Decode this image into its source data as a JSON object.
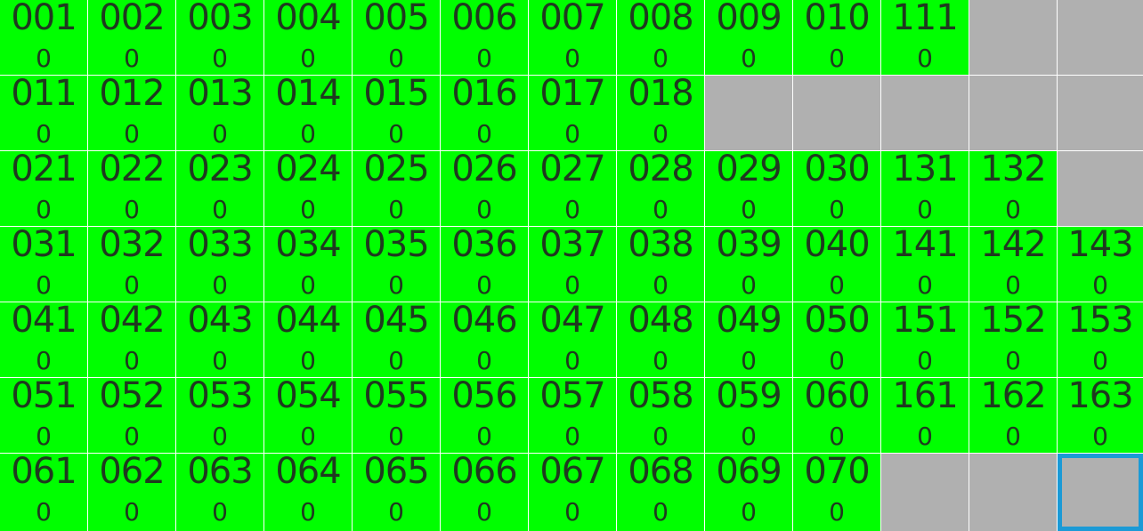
{
  "colors": {
    "active_tile": "#00ff00",
    "empty_tile": "#b0b0b0",
    "selection_border": "#1b9ad6",
    "text": "#1f3a1f",
    "gridline": "#ffffff"
  },
  "grid": {
    "rows": [
      [
        {
          "label": "001",
          "count": "0"
        },
        {
          "label": "002",
          "count": "0"
        },
        {
          "label": "003",
          "count": "0"
        },
        {
          "label": "004",
          "count": "0"
        },
        {
          "label": "005",
          "count": "0"
        },
        {
          "label": "006",
          "count": "0"
        },
        {
          "label": "007",
          "count": "0"
        },
        {
          "label": "008",
          "count": "0"
        },
        {
          "label": "009",
          "count": "0"
        },
        {
          "label": "010",
          "count": "0"
        },
        {
          "label": "111",
          "count": "0"
        },
        {
          "empty": true
        },
        {
          "empty": true
        }
      ],
      [
        {
          "label": "011",
          "count": "0"
        },
        {
          "label": "012",
          "count": "0"
        },
        {
          "label": "013",
          "count": "0"
        },
        {
          "label": "014",
          "count": "0"
        },
        {
          "label": "015",
          "count": "0"
        },
        {
          "label": "016",
          "count": "0"
        },
        {
          "label": "017",
          "count": "0"
        },
        {
          "label": "018",
          "count": "0"
        },
        {
          "empty": true
        },
        {
          "empty": true
        },
        {
          "empty": true
        },
        {
          "empty": true
        },
        {
          "empty": true
        }
      ],
      [
        {
          "label": "021",
          "count": "0"
        },
        {
          "label": "022",
          "count": "0"
        },
        {
          "label": "023",
          "count": "0"
        },
        {
          "label": "024",
          "count": "0"
        },
        {
          "label": "025",
          "count": "0"
        },
        {
          "label": "026",
          "count": "0"
        },
        {
          "label": "027",
          "count": "0"
        },
        {
          "label": "028",
          "count": "0"
        },
        {
          "label": "029",
          "count": "0"
        },
        {
          "label": "030",
          "count": "0"
        },
        {
          "label": "131",
          "count": "0"
        },
        {
          "label": "132",
          "count": "0"
        },
        {
          "empty": true
        }
      ],
      [
        {
          "label": "031",
          "count": "0"
        },
        {
          "label": "032",
          "count": "0"
        },
        {
          "label": "033",
          "count": "0"
        },
        {
          "label": "034",
          "count": "0"
        },
        {
          "label": "035",
          "count": "0"
        },
        {
          "label": "036",
          "count": "0"
        },
        {
          "label": "037",
          "count": "0"
        },
        {
          "label": "038",
          "count": "0"
        },
        {
          "label": "039",
          "count": "0"
        },
        {
          "label": "040",
          "count": "0"
        },
        {
          "label": "141",
          "count": "0"
        },
        {
          "label": "142",
          "count": "0"
        },
        {
          "label": "143",
          "count": "0"
        }
      ],
      [
        {
          "label": "041",
          "count": "0"
        },
        {
          "label": "042",
          "count": "0"
        },
        {
          "label": "043",
          "count": "0"
        },
        {
          "label": "044",
          "count": "0"
        },
        {
          "label": "045",
          "count": "0"
        },
        {
          "label": "046",
          "count": "0"
        },
        {
          "label": "047",
          "count": "0"
        },
        {
          "label": "048",
          "count": "0"
        },
        {
          "label": "049",
          "count": "0"
        },
        {
          "label": "050",
          "count": "0"
        },
        {
          "label": "151",
          "count": "0"
        },
        {
          "label": "152",
          "count": "0"
        },
        {
          "label": "153",
          "count": "0"
        }
      ],
      [
        {
          "label": "051",
          "count": "0"
        },
        {
          "label": "052",
          "count": "0"
        },
        {
          "label": "053",
          "count": "0"
        },
        {
          "label": "054",
          "count": "0"
        },
        {
          "label": "055",
          "count": "0"
        },
        {
          "label": "056",
          "count": "0"
        },
        {
          "label": "057",
          "count": "0"
        },
        {
          "label": "058",
          "count": "0"
        },
        {
          "label": "059",
          "count": "0"
        },
        {
          "label": "060",
          "count": "0"
        },
        {
          "label": "161",
          "count": "0"
        },
        {
          "label": "162",
          "count": "0"
        },
        {
          "label": "163",
          "count": "0"
        }
      ],
      [
        {
          "label": "061",
          "count": "0"
        },
        {
          "label": "062",
          "count": "0"
        },
        {
          "label": "063",
          "count": "0"
        },
        {
          "label": "064",
          "count": "0"
        },
        {
          "label": "065",
          "count": "0"
        },
        {
          "label": "066",
          "count": "0"
        },
        {
          "label": "067",
          "count": "0"
        },
        {
          "label": "068",
          "count": "0"
        },
        {
          "label": "069",
          "count": "0"
        },
        {
          "label": "070",
          "count": "0"
        },
        {
          "empty": true
        },
        {
          "empty": true
        },
        {
          "empty": true,
          "selected": true
        }
      ]
    ]
  }
}
